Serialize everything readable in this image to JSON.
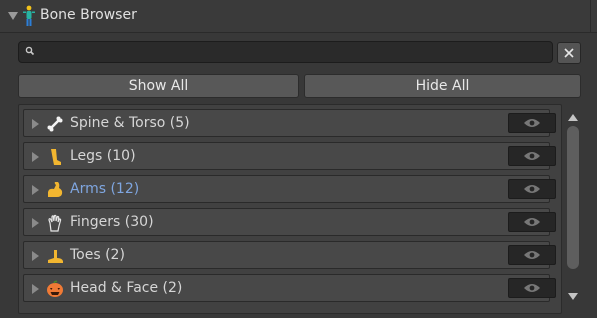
{
  "panel": {
    "title": "Bone Browser",
    "icon": "humanoid-figure-icon"
  },
  "search": {
    "value": "",
    "placeholder": "",
    "clear_label": "✕"
  },
  "buttons": {
    "show_all": "Show All",
    "hide_all": "Hide All"
  },
  "groups": [
    {
      "label": "Spine & Torso (5)",
      "icon": "bone-icon",
      "selected": false
    },
    {
      "label": "Legs (10)",
      "icon": "leg-icon",
      "selected": false
    },
    {
      "label": "Arms (12)",
      "icon": "flexed-biceps-icon",
      "selected": true
    },
    {
      "label": "Fingers (30)",
      "icon": "hand-icon",
      "selected": false
    },
    {
      "label": "Toes (2)",
      "icon": "foot-icon",
      "selected": false
    },
    {
      "label": "Head & Face (2)",
      "icon": "face-icon",
      "selected": false
    }
  ],
  "colors": {
    "selected_text": "#7fa6e0",
    "panel_bg": "#383838"
  }
}
